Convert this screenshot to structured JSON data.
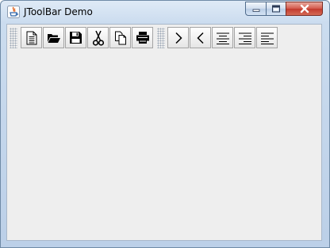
{
  "window": {
    "title": "JToolBar Demo"
  },
  "titlebar_controls": [
    {
      "name": "minimize-button",
      "icon": "minimize-icon"
    },
    {
      "name": "maximize-button",
      "icon": "maximize-icon"
    },
    {
      "name": "close-button",
      "icon": "close-icon"
    }
  ],
  "toolbar": {
    "group1": [
      {
        "name": "new-button",
        "icon": "new-document-icon"
      },
      {
        "name": "open-button",
        "icon": "open-folder-icon"
      },
      {
        "name": "save-button",
        "icon": "save-icon"
      },
      {
        "name": "cut-button",
        "icon": "cut-icon"
      },
      {
        "name": "copy-button",
        "icon": "copy-icon"
      },
      {
        "name": "print-button",
        "icon": "print-icon"
      }
    ],
    "group2": [
      {
        "name": "next-button",
        "icon": "chevron-right-icon"
      },
      {
        "name": "previous-button",
        "icon": "chevron-left-icon"
      },
      {
        "name": "align-center-button",
        "icon": "align-center-icon"
      },
      {
        "name": "align-right-button",
        "icon": "align-right-icon"
      },
      {
        "name": "align-left-button",
        "icon": "align-left-icon"
      }
    ]
  },
  "colors": {
    "titlebar": "#cbdcef",
    "client_background": "#eeeeee",
    "close_button": "#c94a3c"
  }
}
